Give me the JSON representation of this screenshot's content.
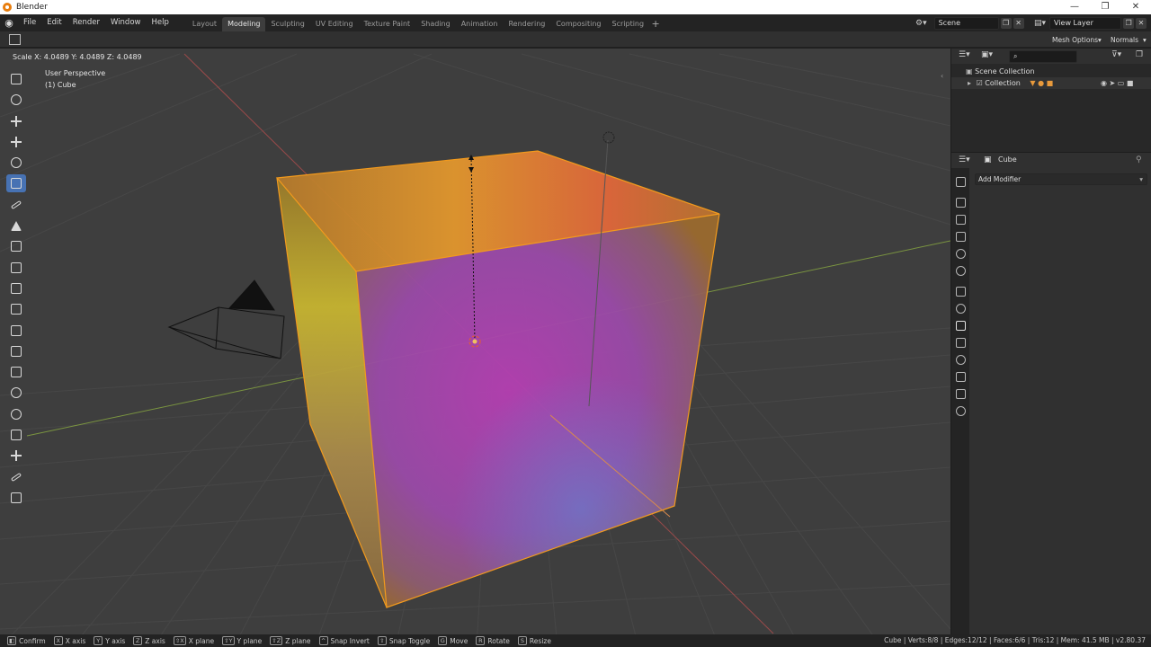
{
  "window": {
    "title": "Blender",
    "buttons": [
      "—",
      "❐",
      "✕"
    ]
  },
  "menu": [
    "File",
    "Edit",
    "Render",
    "Window",
    "Help"
  ],
  "workspaces": [
    "Layout",
    "Modeling",
    "Sculpting",
    "UV Editing",
    "Texture Paint",
    "Shading",
    "Animation",
    "Rendering",
    "Compositing",
    "Scripting"
  ],
  "active_workspace": "Modeling",
  "scene": {
    "name": "Scene",
    "view_layer": "View Layer"
  },
  "header": {
    "mesh_options": "Mesh Options",
    "normals": "Normals"
  },
  "viewport": {
    "operator_info": "Scale X: 4.0489   Y: 4.0489   Z: 4.0489",
    "perspective": "User Perspective",
    "object_label": "(1) Cube"
  },
  "toolbar": [
    {
      "name": "select-box-tool",
      "icon": "select-box-icon"
    },
    {
      "name": "cursor-tool",
      "icon": "cursor-icon"
    },
    {
      "name": "move-tool",
      "icon": "move-icon"
    },
    {
      "name": "move-tool-2",
      "icon": "move-icon"
    },
    {
      "name": "rotate-tool",
      "icon": "rotate-icon"
    },
    {
      "name": "scale-tool",
      "icon": "scale-icon",
      "active": true
    },
    {
      "name": "annotate-tool",
      "icon": "annotate-icon"
    },
    {
      "name": "measure-tool",
      "icon": "measure-icon"
    },
    {
      "name": "add-cube-tool",
      "icon": "add-cube-icon"
    },
    {
      "name": "extrude-tool",
      "icon": "extrude-icon"
    },
    {
      "name": "inset-tool",
      "icon": "inset-icon"
    },
    {
      "name": "bevel-tool",
      "icon": "bevel-icon"
    },
    {
      "name": "loop-cut-tool",
      "icon": "loop-cut-icon"
    },
    {
      "name": "knife-tool",
      "icon": "knife-icon"
    },
    {
      "name": "poly-build-tool",
      "icon": "poly-build-icon"
    },
    {
      "name": "spin-tool",
      "icon": "spin-icon"
    },
    {
      "name": "smooth-tool",
      "icon": "smooth-icon"
    },
    {
      "name": "edge-slide-tool",
      "icon": "edge-slide-icon"
    },
    {
      "name": "shrink-fatten-tool",
      "icon": "shrink-fatten-icon"
    },
    {
      "name": "shear-tool",
      "icon": "shear-icon"
    },
    {
      "name": "rip-tool",
      "icon": "rip-icon"
    }
  ],
  "outliner": {
    "scene_collection": "Scene Collection",
    "collection": "Collection"
  },
  "properties": {
    "object_name": "Cube",
    "add_modifier": "Add Modifier"
  },
  "statusbar": {
    "hints": [
      {
        "key": "◧",
        "label": "Confirm"
      },
      {
        "key": "X",
        "label": "X axis"
      },
      {
        "key": "Y",
        "label": "Y axis"
      },
      {
        "key": "Z",
        "label": "Z axis"
      },
      {
        "key": "⇧X",
        "label": "X plane"
      },
      {
        "key": "⇧Y",
        "label": "Y plane"
      },
      {
        "key": "⇧Z",
        "label": "Z plane"
      },
      {
        "key": "^",
        "label": "Snap Invert"
      },
      {
        "key": "⇧",
        "label": "Snap Toggle"
      },
      {
        "key": "G",
        "label": "Move"
      },
      {
        "key": "R",
        "label": "Rotate"
      },
      {
        "key": "S",
        "label": "Resize"
      }
    ],
    "stats": "Cube | Verts:8/8 | Edges:12/12 | Faces:6/6 | Tris:12 | Mem: 41.5 MB | v2.80.37"
  },
  "colors": {
    "accent": "#4772b3",
    "selection": "#f29a1d",
    "viewport_bg": "#3e3e3e"
  }
}
